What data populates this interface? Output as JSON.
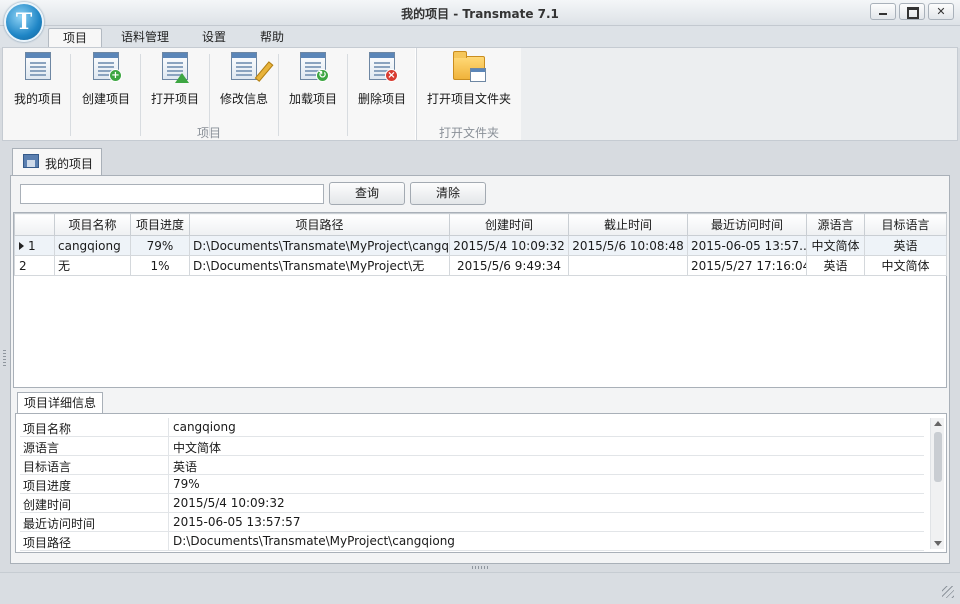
{
  "window": {
    "title": "我的项目 - Transmate 7.1",
    "logo_letter": "T"
  },
  "menu": {
    "tabs": [
      "项目",
      "语料管理",
      "设置",
      "帮助"
    ]
  },
  "ribbon": {
    "buttons": [
      "我的项目",
      "创建项目",
      "打开项目",
      "修改信息",
      "加载项目",
      "删除项目",
      "打开项目文件夹"
    ],
    "groups": [
      "项目",
      "打开文件夹"
    ]
  },
  "doc_tab": {
    "label": "我的项目"
  },
  "search": {
    "value": "",
    "query_label": "查询",
    "clear_label": "清除"
  },
  "grid": {
    "columns": [
      "",
      "项目名称",
      "项目进度",
      "项目路径",
      "创建时间",
      "截止时间",
      "最近访问时间",
      "源语言",
      "目标语言"
    ],
    "rows": [
      [
        "1",
        "cangqiong",
        "79%",
        "D:\\Documents\\Transmate\\MyProject\\cangqi...",
        "2015/5/4 10:09:32",
        "2015/5/6 10:08:48",
        "2015-06-05 13:57...",
        "中文简体",
        "英语"
      ],
      [
        "2",
        "无",
        "1%",
        "D:\\Documents\\Transmate\\MyProject\\无",
        "2015/5/6 9:49:34",
        "",
        "2015/5/27 17:16:04",
        "英语",
        "中文简体"
      ]
    ]
  },
  "details": {
    "tab_label": "项目详细信息",
    "rows": [
      {
        "key": "项目名称",
        "value": "cangqiong"
      },
      {
        "key": "源语言",
        "value": "中文简体"
      },
      {
        "key": "目标语言",
        "value": "英语"
      },
      {
        "key": "项目进度",
        "value": "79%"
      },
      {
        "key": "创建时间",
        "value": "2015/5/4 10:09:32"
      },
      {
        "key": "最近访问时间",
        "value": "2015-06-05 13:57:57"
      },
      {
        "key": "项目路径",
        "value": "D:\\Documents\\Transmate\\MyProject\\cangqiong"
      }
    ]
  }
}
